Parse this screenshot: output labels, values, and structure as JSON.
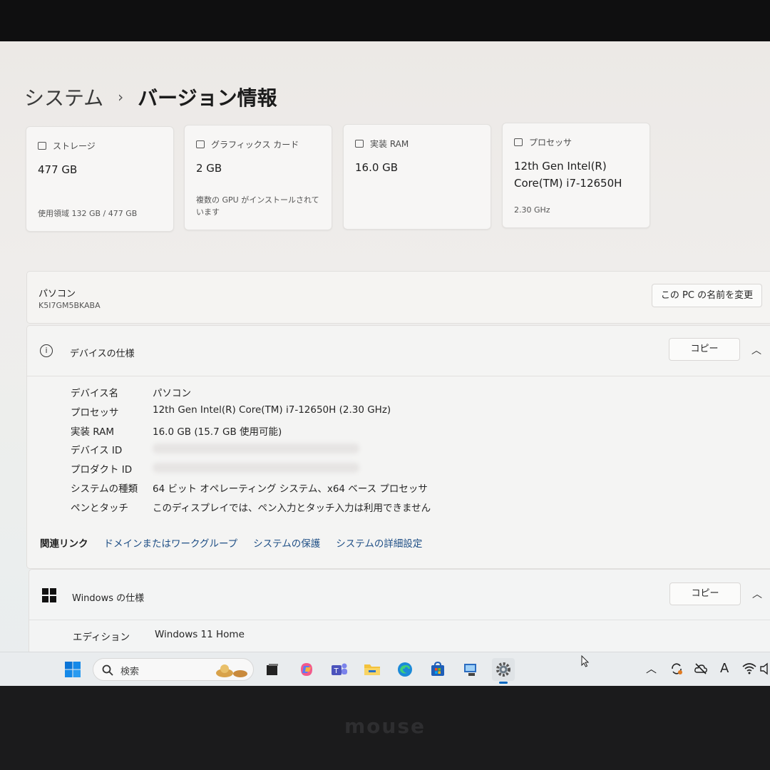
{
  "header": {
    "breadcrumb_parent": "システム",
    "separator": "›",
    "title": "バージョン情報"
  },
  "cards": {
    "storage": {
      "label": "ストレージ",
      "value": "477 GB",
      "sub": "使用領域 132 GB / 477 GB"
    },
    "graphics": {
      "label": "グラフィックス カード",
      "value": "2 GB",
      "sub": "複数の GPU がインストールされています"
    },
    "ram": {
      "label": "実装 RAM",
      "value": "16.0 GB",
      "sub": ""
    },
    "processor": {
      "label": "プロセッサ",
      "value": "12th Gen Intel(R) Core(TM) i7-12650H",
      "sub": "2.30 GHz"
    }
  },
  "pc": {
    "label": "パソコン",
    "id": "K5I7GM5BKABA",
    "rename_button": "この PC の名前を変更"
  },
  "device_specs": {
    "title": "デバイスの仕様",
    "copy_button": "コピー",
    "rows": [
      {
        "label": "デバイス名",
        "value": "パソコン"
      },
      {
        "label": "プロセッサ",
        "value": "12th Gen Intel(R) Core(TM) i7-12650H (2.30 GHz)"
      },
      {
        "label": "実装 RAM",
        "value": "16.0 GB (15.7 GB 使用可能)"
      },
      {
        "label": "デバイス ID",
        "value": ""
      },
      {
        "label": "プロダクト ID",
        "value": ""
      },
      {
        "label": "システムの種類",
        "value": "64 ビット オペレーティング システム、x64 ベース プロセッサ"
      },
      {
        "label": "ペンとタッチ",
        "value": "このディスプレイでは、ペン入力とタッチ入力は利用できません"
      }
    ]
  },
  "related_links": {
    "label": "関連リンク",
    "links": [
      "ドメインまたはワークグループ",
      "システムの保護",
      "システムの詳細設定"
    ]
  },
  "windows_specs": {
    "title": "Windows の仕様",
    "copy_button": "コピー",
    "edition_label": "エディション",
    "edition_value": "Windows 11 Home"
  },
  "taskbar": {
    "search_placeholder": "検索",
    "icons": [
      "start-icon",
      "search-icon",
      "task-view-icon",
      "copilot-icon",
      "teams-icon",
      "file-explorer-icon",
      "edge-icon",
      "store-icon",
      "app-icon",
      "settings-icon"
    ],
    "tray_letter": "A"
  },
  "bezel": {
    "brand": "mouse"
  },
  "colors": {
    "link": "#1f4f86",
    "accent": "#0067c0"
  }
}
